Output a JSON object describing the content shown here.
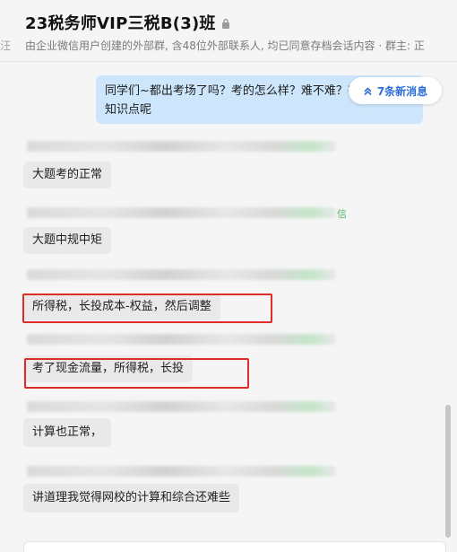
{
  "header": {
    "title": "23税务师VIP三税B(3)班",
    "subtitle": "由企业微信用户创建的外部群, 含48位外部联系人, 均已同意存档会话内容 · 群主: 正",
    "left_edge_text": "汪"
  },
  "outgoing_message": {
    "text": "同学们~都出考场了吗？考的怎么样？难不难？有没有哪些知识点呢"
  },
  "new_messages_button": {
    "label": "7条新消息"
  },
  "sender_fragment_text": "信",
  "messages": [
    {
      "text": "大题考的正常"
    },
    {
      "text": "大题中规中矩"
    },
    {
      "text": "所得税，长投成本-权益，然后调整"
    },
    {
      "text": "考了现金流量，所得税，长投"
    },
    {
      "text": "计算也正常，"
    },
    {
      "text": "讲道理我觉得网校的计算和综合还难些"
    }
  ],
  "colors": {
    "highlight": "#e02b2b",
    "outgoing_bubble": "#cde6fb",
    "incoming_bubble": "#e9e9e9",
    "link_blue": "#2d6fd8"
  }
}
